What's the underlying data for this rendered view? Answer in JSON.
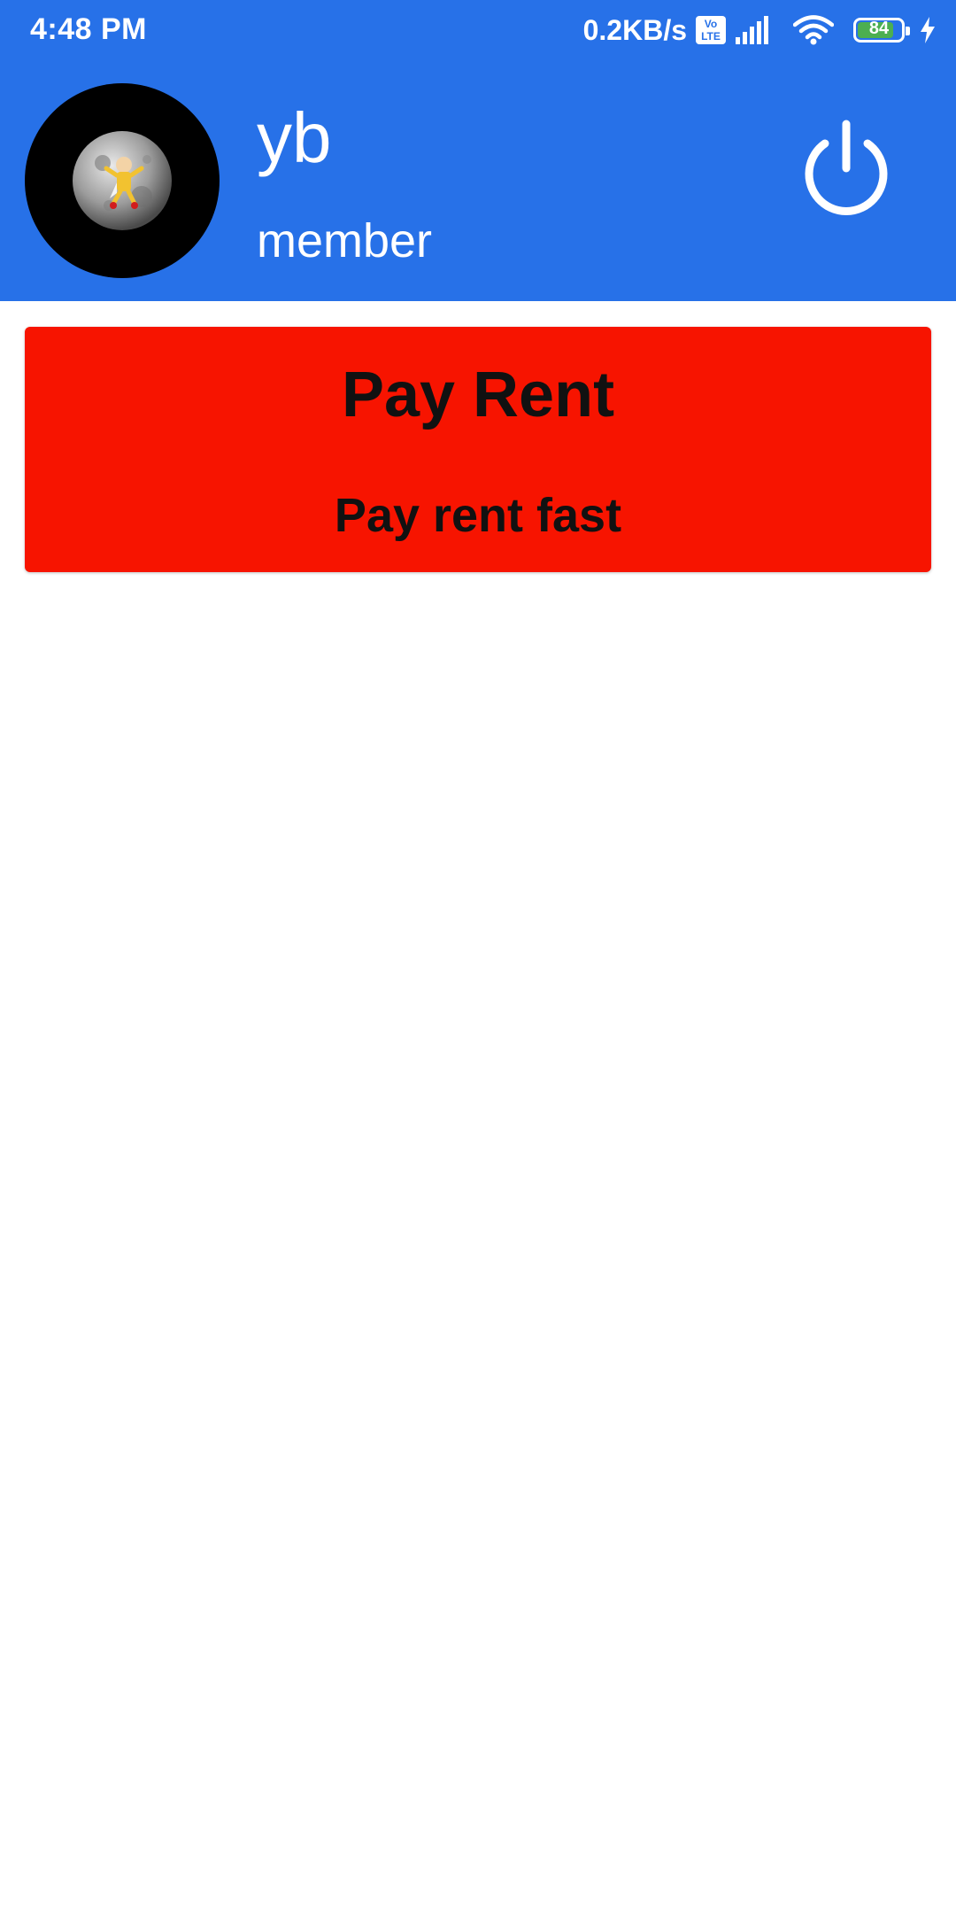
{
  "status_bar": {
    "time": "4:48 PM",
    "net_speed": "0.2KB/s",
    "volte_top": "Vo",
    "volte_bottom": "LTE",
    "battery_level": "84",
    "battery_percent": 84,
    "icons": [
      "volte-icon",
      "signal-icon",
      "wifi-icon",
      "battery-icon",
      "charging-icon"
    ]
  },
  "profile": {
    "name": "yb",
    "role": "member",
    "avatar_icon": "avatar-image",
    "logout_icon": "power-icon"
  },
  "card": {
    "title": "Pay Rent",
    "subtitle": "Pay rent fast"
  },
  "colors": {
    "header": "#2771e8",
    "card": "#f71400",
    "text_on_card": "#111111",
    "background": "#ffffff"
  }
}
